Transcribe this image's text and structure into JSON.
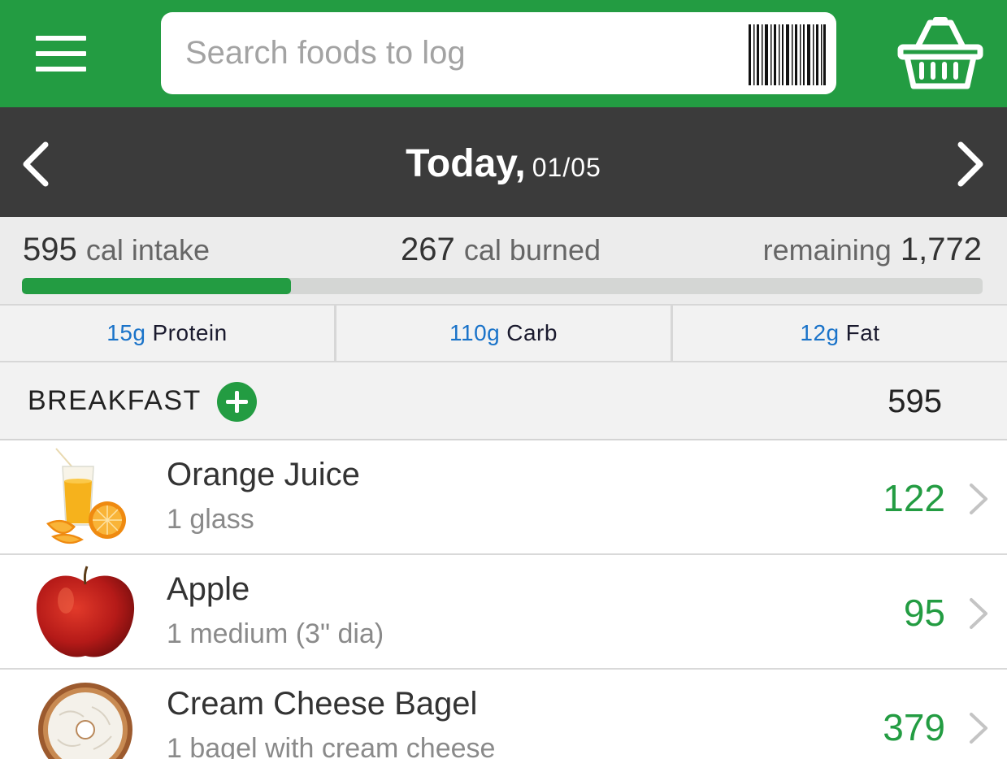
{
  "search": {
    "placeholder": "Search foods to log"
  },
  "icons": {
    "menu": "menu-icon",
    "barcode": "barcode-icon",
    "basket": "basket-icon",
    "prev": "chevron-left-icon",
    "next": "chevron-right-icon",
    "add": "plus-icon"
  },
  "colors": {
    "brand_green": "#239c42",
    "date_bar": "#3b3b3b",
    "macro_blue": "#1a73c9"
  },
  "date": {
    "label": "Today,",
    "value": "01/05"
  },
  "summary": {
    "intake_value": "595",
    "intake_label": "cal intake",
    "burned_value": "267",
    "burned_label": "cal burned",
    "remaining_label": "remaining",
    "remaining_value": "1,772",
    "progress_fraction": 0.28
  },
  "macros": [
    {
      "amount": "15g",
      "label": "Protein"
    },
    {
      "amount": "110g",
      "label": "Carb"
    },
    {
      "amount": "12g",
      "label": "Fat"
    }
  ],
  "meal": {
    "name": "BREAKFAST",
    "total": "595",
    "items": [
      {
        "name": "Orange Juice",
        "serving": "1 glass",
        "calories": "122",
        "image": "orange-juice-image"
      },
      {
        "name": "Apple",
        "serving": "1 medium (3\" dia)",
        "calories": "95",
        "image": "apple-image"
      },
      {
        "name": "Cream Cheese Bagel",
        "serving": "1 bagel with cream cheese",
        "calories": "379",
        "image": "bagel-image"
      }
    ]
  }
}
